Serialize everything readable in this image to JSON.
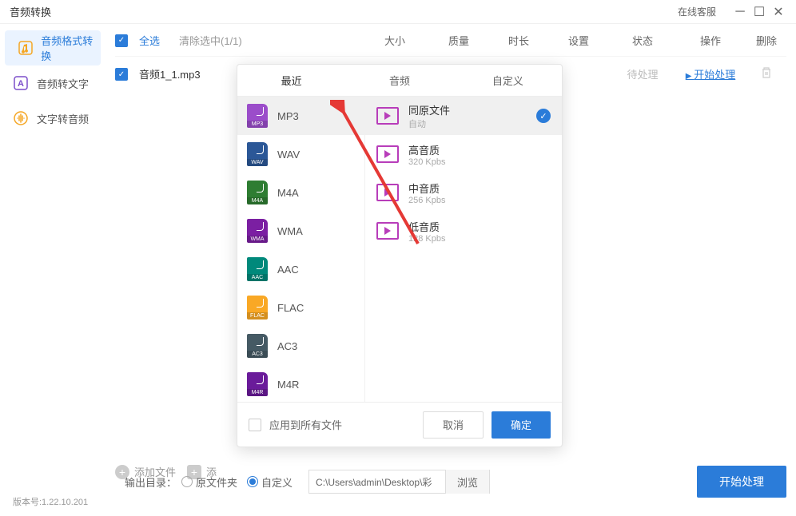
{
  "titlebar": {
    "title": "音频转换",
    "customerService": "在线客服"
  },
  "sidebar": {
    "items": [
      {
        "label": "音频格式转换"
      },
      {
        "label": "音频转文字"
      },
      {
        "label": "文字转音频"
      }
    ]
  },
  "header": {
    "selectAll": "全选",
    "clearSelection": "清除选中(1/1)",
    "cols": {
      "size": "大小",
      "quality": "质量",
      "duration": "时长",
      "settings": "设置",
      "status": "状态",
      "action": "操作",
      "delete": "删除"
    }
  },
  "files": [
    {
      "name": "音频1_1.mp3",
      "status": "待处理",
      "action": "开始处理"
    }
  ],
  "bottom": {
    "addFile": "添加文件",
    "addFolder": "添"
  },
  "output": {
    "label": "输出目录：",
    "original": "原文件夹",
    "custom": "自定义",
    "path": "C:\\Users\\admin\\Desktop\\彩",
    "browse": "浏览",
    "startAll": "开始处理"
  },
  "version": "版本号:1.22.10.201",
  "popup": {
    "tabs": {
      "recent": "最近",
      "audio": "音频",
      "custom": "自定义"
    },
    "formats": [
      {
        "label": "MP3",
        "badge": "MP3",
        "color": "#9b4dca"
      },
      {
        "label": "WAV",
        "badge": "WAV",
        "color": "#2b5797"
      },
      {
        "label": "M4A",
        "badge": "M4A",
        "color": "#2e7d32"
      },
      {
        "label": "WMA",
        "badge": "WMA",
        "color": "#7b1fa2"
      },
      {
        "label": "AAC",
        "badge": "AAC",
        "color": "#00897b"
      },
      {
        "label": "FLAC",
        "badge": "FLAC",
        "color": "#f9a825"
      },
      {
        "label": "AC3",
        "badge": "AC3",
        "color": "#455a64"
      },
      {
        "label": "M4R",
        "badge": "M4R",
        "color": "#6a1b9a"
      }
    ],
    "qualities": [
      {
        "name": "同原文件",
        "sub": "自动"
      },
      {
        "name": "高音质",
        "sub": "320 Kpbs"
      },
      {
        "name": "中音质",
        "sub": "256 Kpbs"
      },
      {
        "name": "低音质",
        "sub": "128 Kpbs"
      }
    ],
    "footer": {
      "applyAll": "应用到所有文件",
      "cancel": "取消",
      "ok": "确定"
    }
  }
}
